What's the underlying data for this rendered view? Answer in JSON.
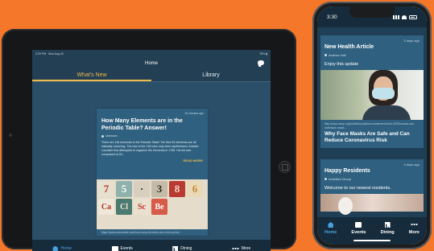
{
  "ipad": {
    "status": {
      "left": "3:29 PM · Mon Aug 30",
      "right": "78% ▮"
    },
    "header_title": "Home",
    "tabs": [
      {
        "label": "What's New",
        "active": true
      },
      {
        "label": "Library",
        "active": false
      }
    ],
    "card": {
      "time": "16 minutes ago",
      "title": "How Many Elements are in the Periodic Table? Answer!",
      "author": "Unknown",
      "body": "There are 118 elements in the Periodic Table! The first 94 elements are all naturally occurring. The rest of the 118 have only been synthesized. Antoine Lavoisier first attempted to organize the elements in 1789. His list was comprised of 33...",
      "read_more": "READ MORE",
      "url": "https://www.sciencekid.com/how-many-elements-are-in-the-period..."
    },
    "tiles": [
      {
        "text": "7",
        "bg": "#e7dfcf",
        "fg": "#b7372f"
      },
      {
        "text": "5",
        "bg": "#8fb2ac",
        "fg": "#ffffff"
      },
      {
        "text": "·",
        "bg": "#d8cfbf",
        "fg": "#333333"
      },
      {
        "text": "3",
        "bg": "#c4bba6",
        "fg": "#2b2b2b"
      },
      {
        "text": "8",
        "bg": "#b83a33",
        "fg": "#f0d6c8"
      },
      {
        "text": "Ca",
        "bg": "#efe7d8",
        "fg": "#b33a2c"
      },
      {
        "text": "Cl",
        "bg": "#4b7a6f",
        "fg": "#f0e6d6"
      },
      {
        "text": "Sc",
        "bg": "#e9e0cf",
        "fg": "#c0392b"
      },
      {
        "text": "Be",
        "bg": "#d65b48",
        "fg": "#ffffff"
      },
      {
        "text": "6",
        "bg": "#e9d9b6",
        "fg": "#c28a3a"
      }
    ],
    "bottom_nav": [
      {
        "label": "Home",
        "icon": "home-icon",
        "active": true
      },
      {
        "label": "Events",
        "icon": "calendar-icon",
        "active": false
      },
      {
        "label": "Dining",
        "icon": "fork-knife-icon",
        "active": false
      },
      {
        "label": "More",
        "icon": "more-dots-icon",
        "active": false
      }
    ]
  },
  "iphone": {
    "status": {
      "time": "3:30"
    },
    "posts": [
      {
        "time": "3 days ago",
        "title": "New Health Article",
        "author": "Andrew Hall",
        "body": "Enjoy this update",
        "url": "http://www.aarp.org/health/conditions-treatments/info-2020/masks-are-safe/face-mask...",
        "headline": "Why Face Masks Are Safe and Can Reduce Coronavirus Risk"
      },
      {
        "time": "3 days ago",
        "title": "Happy Residents",
        "author": "Activities Group",
        "body": "Welcome to our newest residents."
      }
    ],
    "bottom_nav": [
      {
        "label": "Home",
        "icon": "home-icon",
        "active": true
      },
      {
        "label": "Events",
        "icon": "calendar-icon",
        "active": false
      },
      {
        "label": "Dining",
        "icon": "fork-knife-icon",
        "active": false
      },
      {
        "label": "More",
        "icon": "more-dots-icon",
        "active": false
      }
    ]
  },
  "colors": {
    "background": "#f4772a",
    "app_header": "#233f54",
    "card": "#2f607f",
    "accent": "#f0b94a",
    "nav_active": "#4aa3e0"
  }
}
